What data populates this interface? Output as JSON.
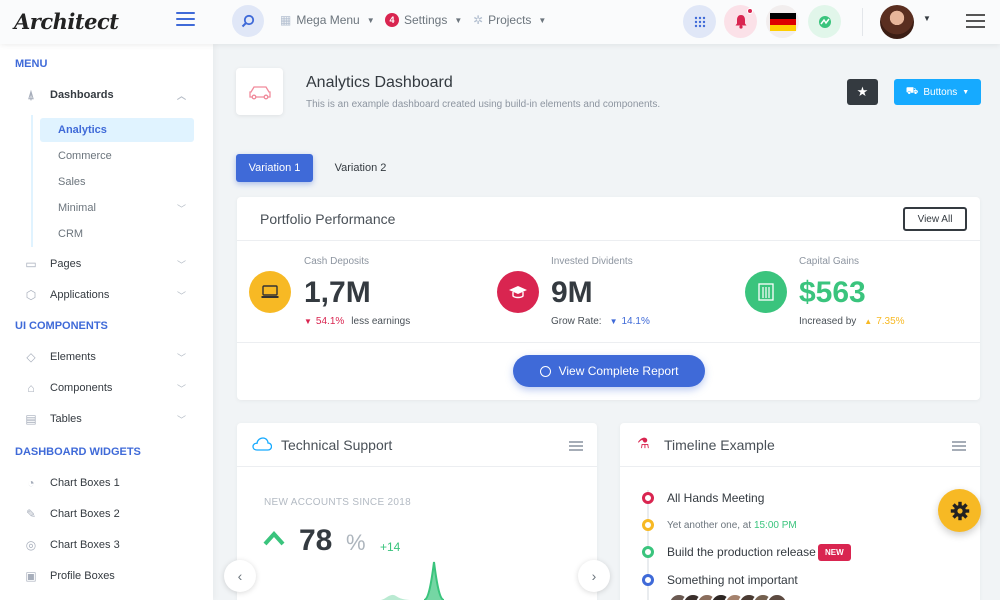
{
  "app": {
    "logo": "Architect"
  },
  "header": {
    "nav": [
      {
        "label": "Mega Menu"
      },
      {
        "label": "Settings",
        "badge": "4"
      },
      {
        "label": "Projects"
      }
    ]
  },
  "sidebar": {
    "sections": {
      "menu": "MENU",
      "ui": "UI COMPONENTS",
      "widgets": "DASHBOARD WIDGETS"
    },
    "dashboards": "Dashboards",
    "sub": [
      "Analytics",
      "Commerce",
      "Sales",
      "Minimal",
      "CRM"
    ],
    "pages": "Pages",
    "applications": "Applications",
    "elements": "Elements",
    "components": "Components",
    "tables": "Tables",
    "chart_boxes_1": "Chart Boxes 1",
    "chart_boxes_2": "Chart Boxes 2",
    "chart_boxes_3": "Chart Boxes 3",
    "profile_boxes": "Profile Boxes"
  },
  "page": {
    "title": "Analytics Dashboard",
    "subtitle": "This is an example dashboard created using build-in elements and components.",
    "buttons_label": "Buttons"
  },
  "tabs": [
    "Variation 1",
    "Variation 2"
  ],
  "portfolio": {
    "title": "Portfolio Performance",
    "view_all": "View All",
    "metrics": [
      {
        "label": "Cash Deposits",
        "value": "1,7M",
        "sub_value": "54.1%",
        "sub_text": "less earnings",
        "color": "#f7b924"
      },
      {
        "label": "Invested Dividents",
        "value": "9M",
        "sub_text": "Grow Rate:",
        "sub_value": "14.1%",
        "color": "#d92550"
      },
      {
        "label": "Capital Gains",
        "value": "$563",
        "sub_text": "Increased by",
        "sub_value": "7.35%",
        "color": "#3ac47d"
      }
    ],
    "report_button": "View Complete Report"
  },
  "support": {
    "title": "Technical Support",
    "accounts_label": "NEW ACCOUNTS SINCE 2018",
    "value": "78",
    "unit": "%",
    "delta": "+14"
  },
  "timeline": {
    "title": "Timeline Example",
    "items": [
      {
        "text": "All Hands Meeting",
        "color": "#d92550"
      },
      {
        "text": "Yet another one, at",
        "time": "15:00 PM",
        "color": "#f7b924"
      },
      {
        "text": "Build the production release",
        "badge": "NEW",
        "color": "#3ac47d"
      },
      {
        "text": "Something not important",
        "color": "#3f6ad8"
      }
    ]
  }
}
